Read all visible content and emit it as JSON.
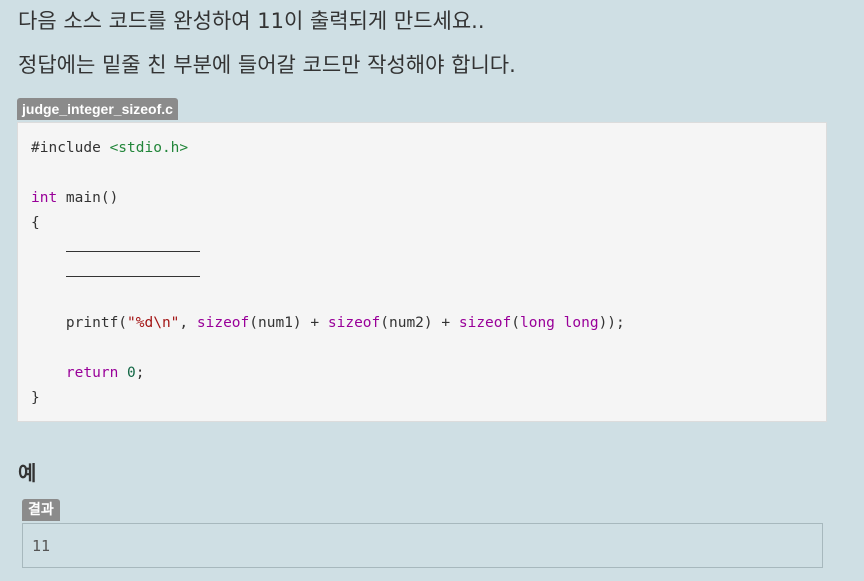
{
  "problem": {
    "line1": "다음 소스 코드를 완성하여 11이 출력되게 만드세요..",
    "line2": "정답에는 밑줄 친 부분에 들어갈 코드만 작성해야 합니다."
  },
  "code": {
    "filename": "judge_integer_sizeof.c",
    "include_directive": "#include",
    "include_header": "<stdio.h>",
    "main_type": "int",
    "main_sig": " main()",
    "open_brace": "{",
    "printf_name": "printf(",
    "format_string": "\"%d\\n\"",
    "comma": ", ",
    "sizeof_kw": "sizeof",
    "arg1": "(num1)",
    "plus": " + ",
    "arg2": "(num2)",
    "arg3_open": "(",
    "long_kw": "long long",
    "arg3_close": "));",
    "return_kw": "return",
    "return_value": "0",
    "semicolon": ";",
    "close_brace": "}"
  },
  "example": {
    "heading": "예",
    "result_label": "결과",
    "result_value": "11"
  }
}
